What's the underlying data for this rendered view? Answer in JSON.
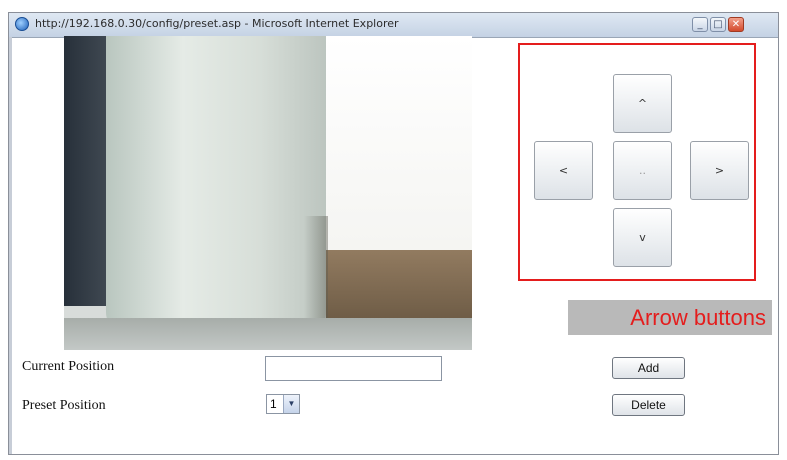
{
  "window": {
    "title": "http://192.168.0.30/config/preset.asp - Microsoft Internet Explorer",
    "controls": {
      "minimize": "_",
      "maximize": "□",
      "close": "✕"
    }
  },
  "ptz": {
    "up_label": "^",
    "left_label": "<",
    "center_label": "..",
    "right_label": ">",
    "down_label": "v"
  },
  "callout": {
    "text": "Arrow buttons"
  },
  "form": {
    "current_position_label": "Current Position",
    "current_position_value": "",
    "preset_position_label": "Preset Position",
    "preset_position_value": "1",
    "add_label": "Add",
    "delete_label": "Delete"
  },
  "colors": {
    "highlight": "#e41d1d",
    "callout_bg": "#b9b9b9"
  },
  "icons": {
    "browser": "ie-icon",
    "dropdown": "chevron-down-icon"
  }
}
